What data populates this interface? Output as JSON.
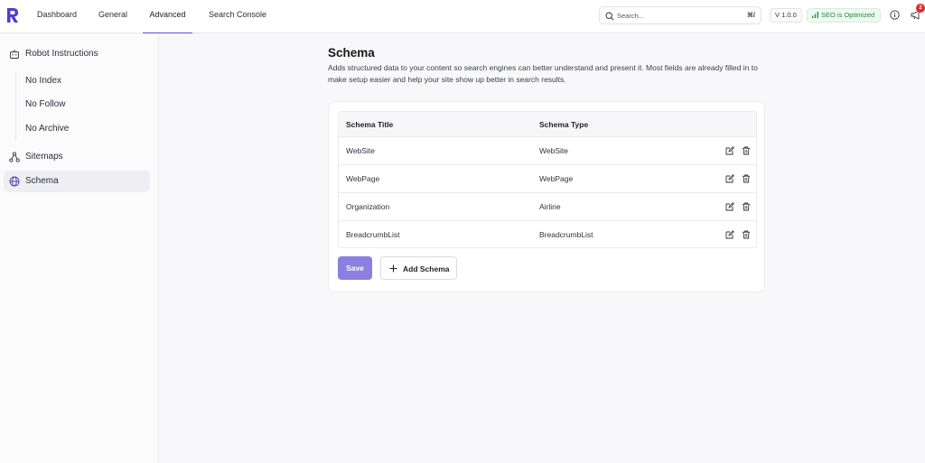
{
  "header": {
    "tabs": [
      {
        "label": "Dashboard"
      },
      {
        "label": "General"
      },
      {
        "label": "Advanced",
        "active": true
      },
      {
        "label": "Search Console"
      }
    ],
    "search": {
      "placeholder": "Search...",
      "shortcut": "⌘/"
    },
    "version": "V 1.0.0",
    "seo_status": "SEO is Optimized",
    "notification_count": "2"
  },
  "sidebar": {
    "items": [
      {
        "label": "Robot Instructions",
        "icon": "robot-icon"
      },
      {
        "label": "Sitemaps",
        "icon": "sitemap-icon"
      },
      {
        "label": "Schema",
        "icon": "globe-icon",
        "active": true
      }
    ],
    "sub_items": [
      {
        "label": "No Index"
      },
      {
        "label": "No Follow"
      },
      {
        "label": "No Archive"
      }
    ]
  },
  "main": {
    "title": "Schema",
    "description": "Adds structured data to your content so search engines can better understand and present it. Most fields are already filled in to make setup easier and help your site show up better in search results.",
    "table": {
      "columns": [
        "Schema Title",
        "Schema Type"
      ],
      "rows": [
        {
          "title": "WebSite",
          "type": "WebSite"
        },
        {
          "title": "WebPage",
          "type": "WebPage"
        },
        {
          "title": "Organization",
          "type": "Airline"
        },
        {
          "title": "BreadcrumbList",
          "type": "BreadcrumbList"
        }
      ]
    },
    "save_label": "Save",
    "add_label": "Add Schema"
  },
  "colors": {
    "accent": "#5b4fd6",
    "save_button": "#8b7fe0",
    "seo_green": "#1e8a3a",
    "badge_red": "#e5292b"
  }
}
